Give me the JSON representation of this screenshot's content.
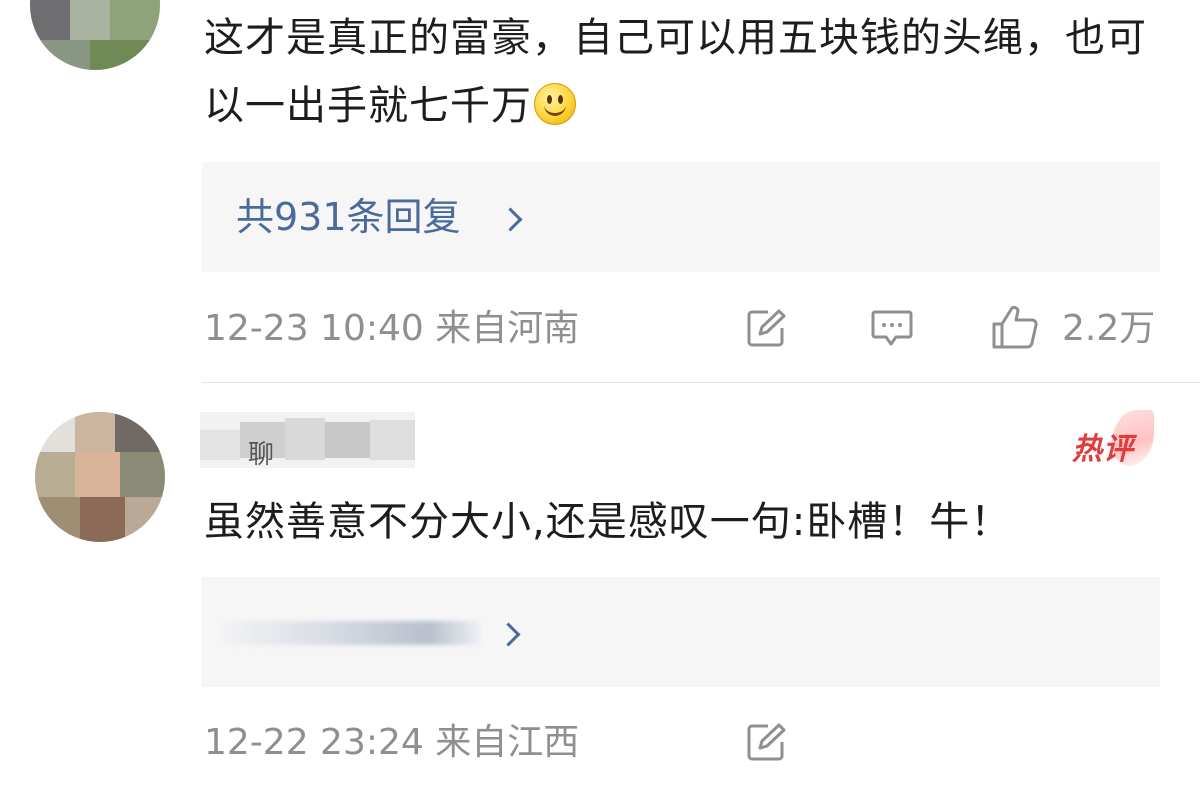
{
  "comments": [
    {
      "text": "这才是真正的富豪，自己可以用五块钱的头绳，也可以一出手就七千万",
      "emoji": "smile-emoji",
      "reply_link": "共931条回复",
      "timestamp": "12-23 10:40",
      "location": "来自河南",
      "like_count": "2.2万",
      "icons": [
        "share-icon",
        "comment-icon",
        "like-icon"
      ]
    },
    {
      "username_fragment": "聊",
      "hot_badge": "热评",
      "text": "虽然善意不分大小,还是感叹一句:卧槽！牛！",
      "timestamp": "12-22 23:24",
      "location": "来自江西",
      "icons": [
        "share-icon"
      ]
    }
  ],
  "colors": {
    "link": "#4a6a9c",
    "meta": "#8f8f8f",
    "hot_badge": "#e23b3b",
    "reply_box_bg": "#f6f6f7"
  }
}
